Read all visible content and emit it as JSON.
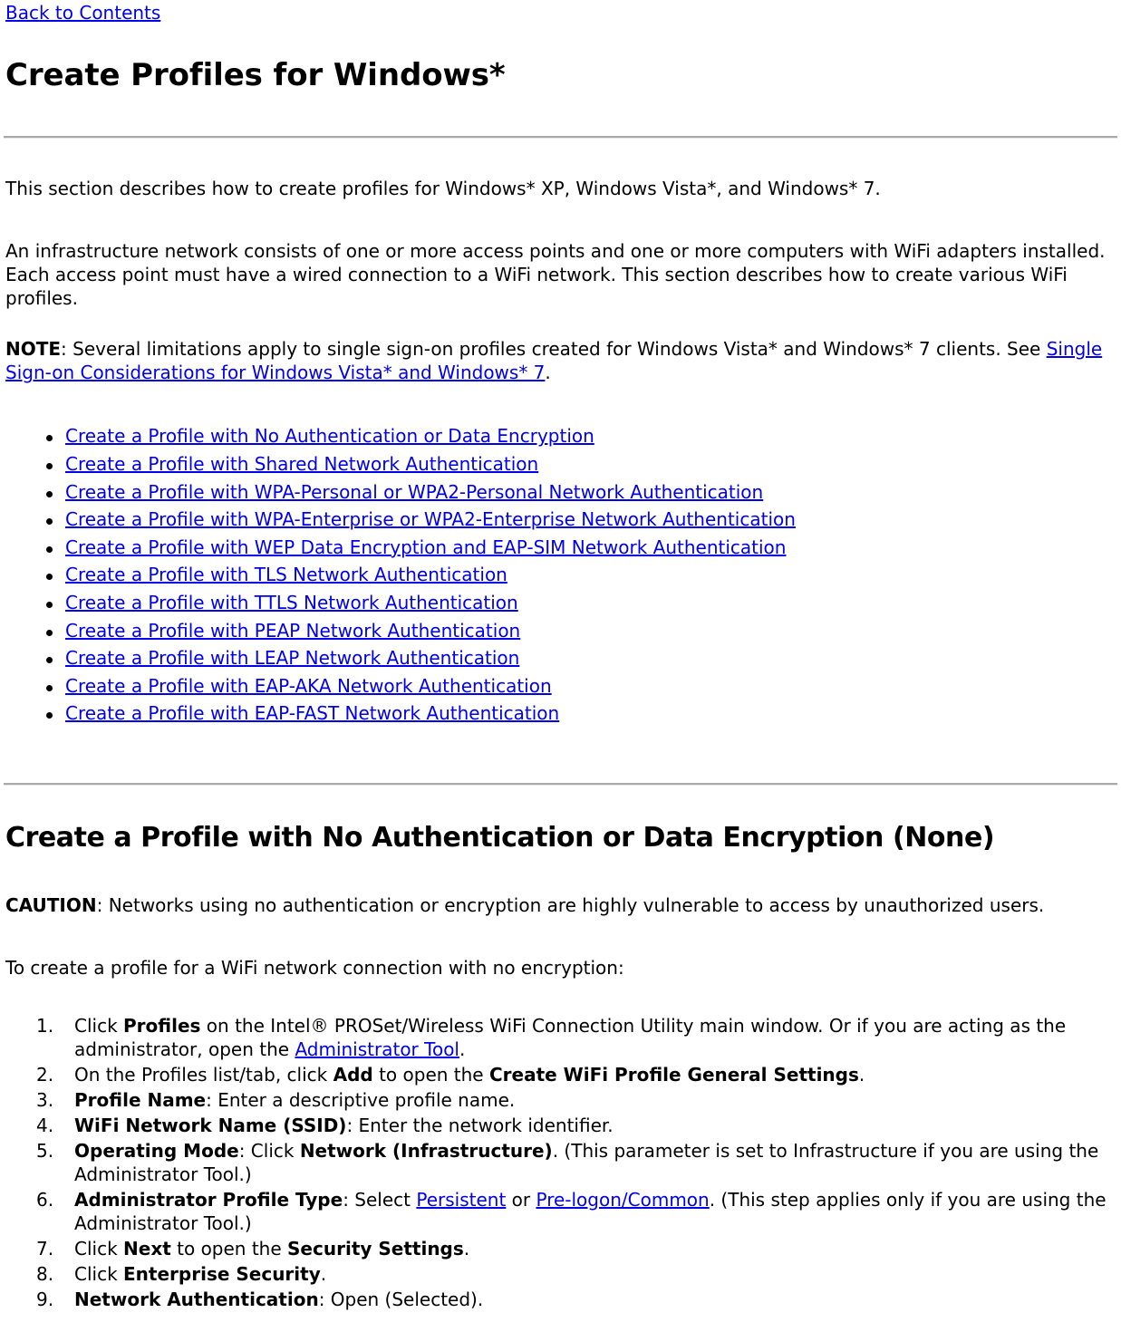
{
  "nav": {
    "back_link": "Back to Contents"
  },
  "page_title": "Create Profiles for Windows*",
  "intro": {
    "para1": "This section describes how to create profiles for Windows* XP, Windows Vista*, and Windows* 7.",
    "para2": "An infrastructure network consists of one or more access points and one or more computers with WiFi adapters installed. Each access point must have a wired connection to a WiFi network. This section describes how to create various WiFi profiles.",
    "note_label": "NOTE",
    "note_text_before": ": Several limitations apply to single sign-on profiles created for Windows Vista* and Windows* 7 clients. See ",
    "note_link": "Single Sign-on Considerations for Windows Vista* and Windows* 7",
    "note_text_after": "."
  },
  "toc_links": [
    "Create a Profile with No Authentication or Data Encryption",
    "Create a Profile with Shared Network Authentication",
    "Create a Profile with WPA-Personal or WPA2-Personal Network Authentication",
    "Create a Profile with WPA-Enterprise or WPA2-Enterprise Network Authentication",
    "Create a Profile with WEP Data Encryption and EAP-SIM Network Authentication",
    "Create a Profile with TLS Network Authentication",
    "Create a Profile with TTLS Network Authentication",
    "Create a Profile with PEAP Network Authentication",
    "Create a Profile with LEAP Network Authentication",
    "Create a Profile with EAP-AKA Network Authentication",
    "Create a Profile with EAP-FAST Network Authentication"
  ],
  "section": {
    "heading": "Create a Profile with No Authentication or Data Encryption (None)",
    "caution_label": "CAUTION",
    "caution_text": ": Networks using no authentication or encryption are highly vulnerable to access by unauthorized users.",
    "lead_in": "To create a profile for a WiFi network connection with no encryption:"
  },
  "steps": [
    {
      "seg1_plain": "Click ",
      "seg2_bold": "Profiles",
      "seg3_plain": " on the Intel® PROSet/Wireless WiFi Connection Utility main window. Or if you are acting as the administrator, open the ",
      "seg4_link": "Administrator Tool",
      "seg5_plain": "."
    },
    {
      "seg1_plain": "On the Profiles list/tab, click ",
      "seg2_bold": "Add",
      "seg3_plain": " to open the ",
      "seg4_bold": "Create WiFi Profile General Settings",
      "seg5_plain": "."
    },
    {
      "seg1_bold": "Profile Name",
      "seg2_plain": ": Enter a descriptive profile name."
    },
    {
      "seg1_bold": "WiFi Network Name (SSID)",
      "seg2_plain": ": Enter the network identifier."
    },
    {
      "seg1_bold": "Operating Mode",
      "seg2_plain": ": Click ",
      "seg3_bold": "Network (Infrastructure)",
      "seg4_plain": ". (This parameter is set to Infrastructure if you are using the Administrator Tool.)"
    },
    {
      "seg1_bold": "Administrator Profile Type",
      "seg2_plain": ": Select ",
      "seg3_link": "Persistent",
      "seg4_plain": " or ",
      "seg5_link": "Pre-logon/Common",
      "seg6_plain": ". (This step applies only if you are using the Administrator Tool.)"
    },
    {
      "seg1_plain": "Click ",
      "seg2_bold": "Next",
      "seg3_plain": " to open the ",
      "seg4_bold": "Security Settings",
      "seg5_plain": "."
    },
    {
      "seg1_plain": "Click ",
      "seg2_bold": "Enterprise Security",
      "seg3_plain": "."
    },
    {
      "seg1_bold": "Network Authentication",
      "seg2_plain": ": Open (Selected)."
    }
  ],
  "colors": {
    "link": "#0000EE",
    "text": "#000000",
    "rule_dark": "#A9A9A9",
    "rule_light": "#E6E6E6",
    "background": "#FFFFFF"
  }
}
